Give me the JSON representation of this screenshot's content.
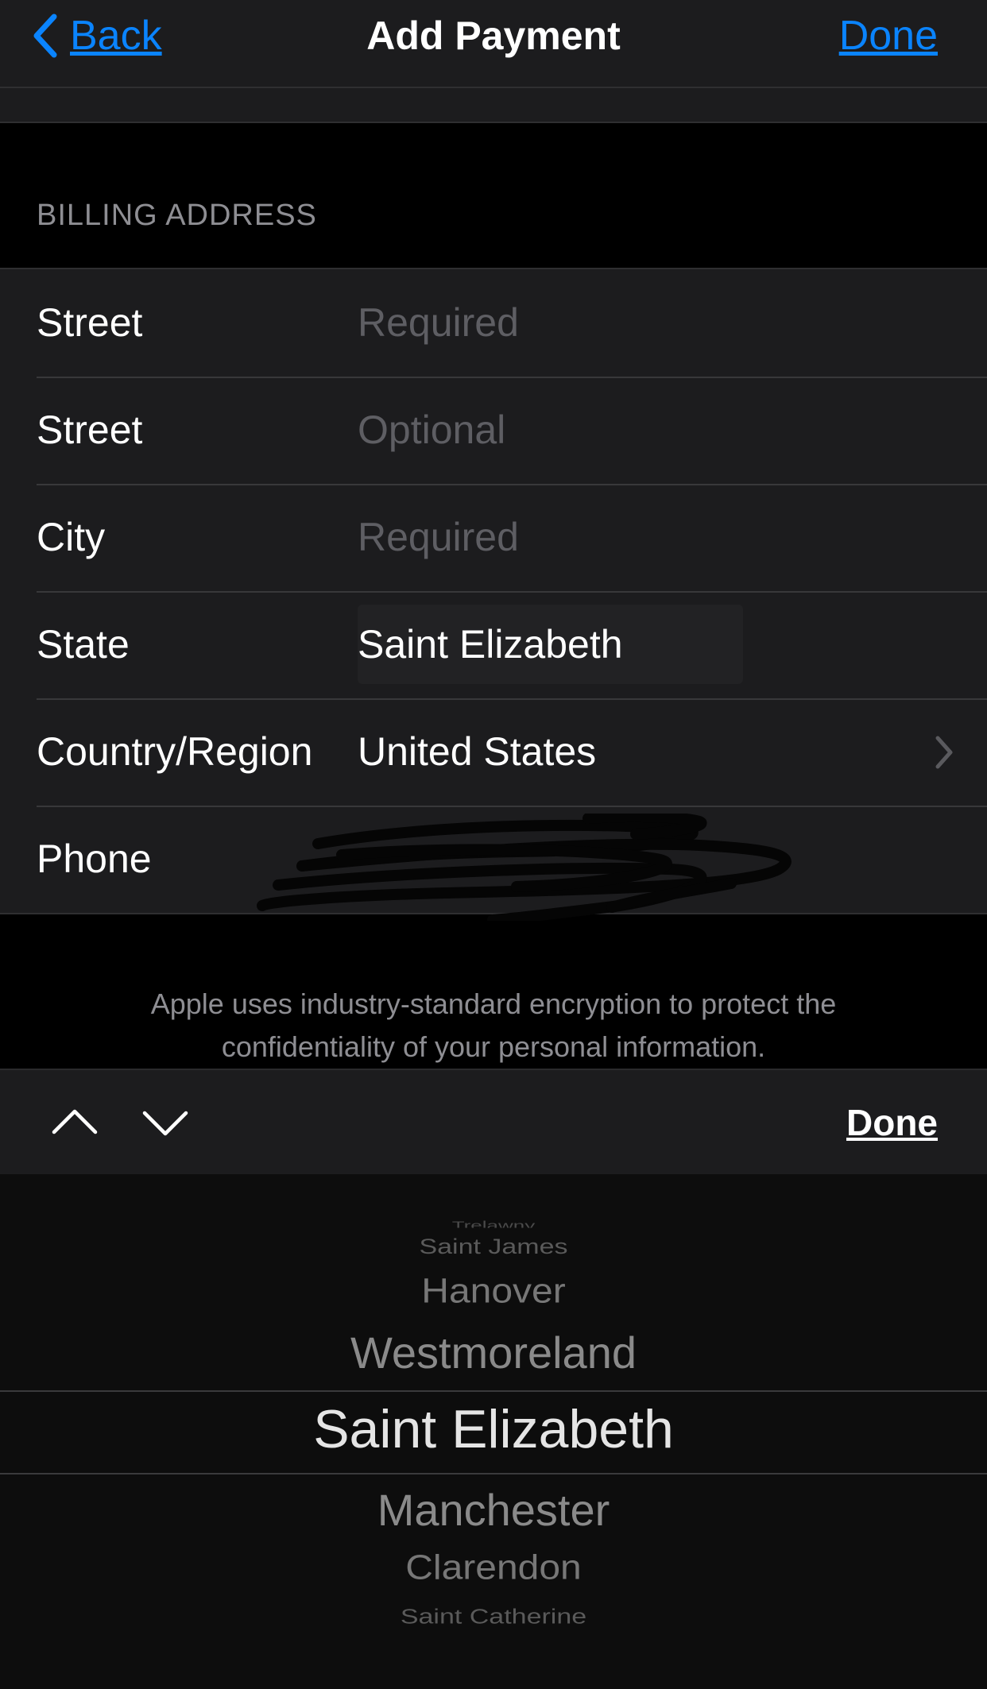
{
  "nav": {
    "back_label": "Back",
    "title": "Add Payment",
    "done_label": "Done"
  },
  "section": {
    "header": "BILLING ADDRESS"
  },
  "form": {
    "street1": {
      "label": "Street",
      "placeholder": "Required"
    },
    "street2": {
      "label": "Street",
      "placeholder": "Optional"
    },
    "city": {
      "label": "City",
      "placeholder": "Required"
    },
    "state": {
      "label": "State",
      "value": "Saint Elizabeth"
    },
    "country": {
      "label": "Country/Region",
      "value": "United States"
    },
    "phone": {
      "label": "Phone"
    }
  },
  "footer_note": "Apple uses industry-standard encryption to protect the confidentiality of your personal information.",
  "toolbar": {
    "up_icon": "chevron-up-icon",
    "down_icon": "chevron-down-icon",
    "done_label": "Done"
  },
  "picker": {
    "items": [
      "Trelawny",
      "Saint James",
      "Hanover",
      "Westmoreland",
      "Saint Elizabeth",
      "Manchester",
      "Clarendon",
      "Saint Catherine"
    ],
    "selected": "Saint Elizabeth"
  },
  "colors": {
    "accent": "#0a84ff",
    "background": "#000000",
    "cell": "#1c1c1e",
    "placeholder": "#5e5e63",
    "secondary_text": "#8e8e93"
  }
}
